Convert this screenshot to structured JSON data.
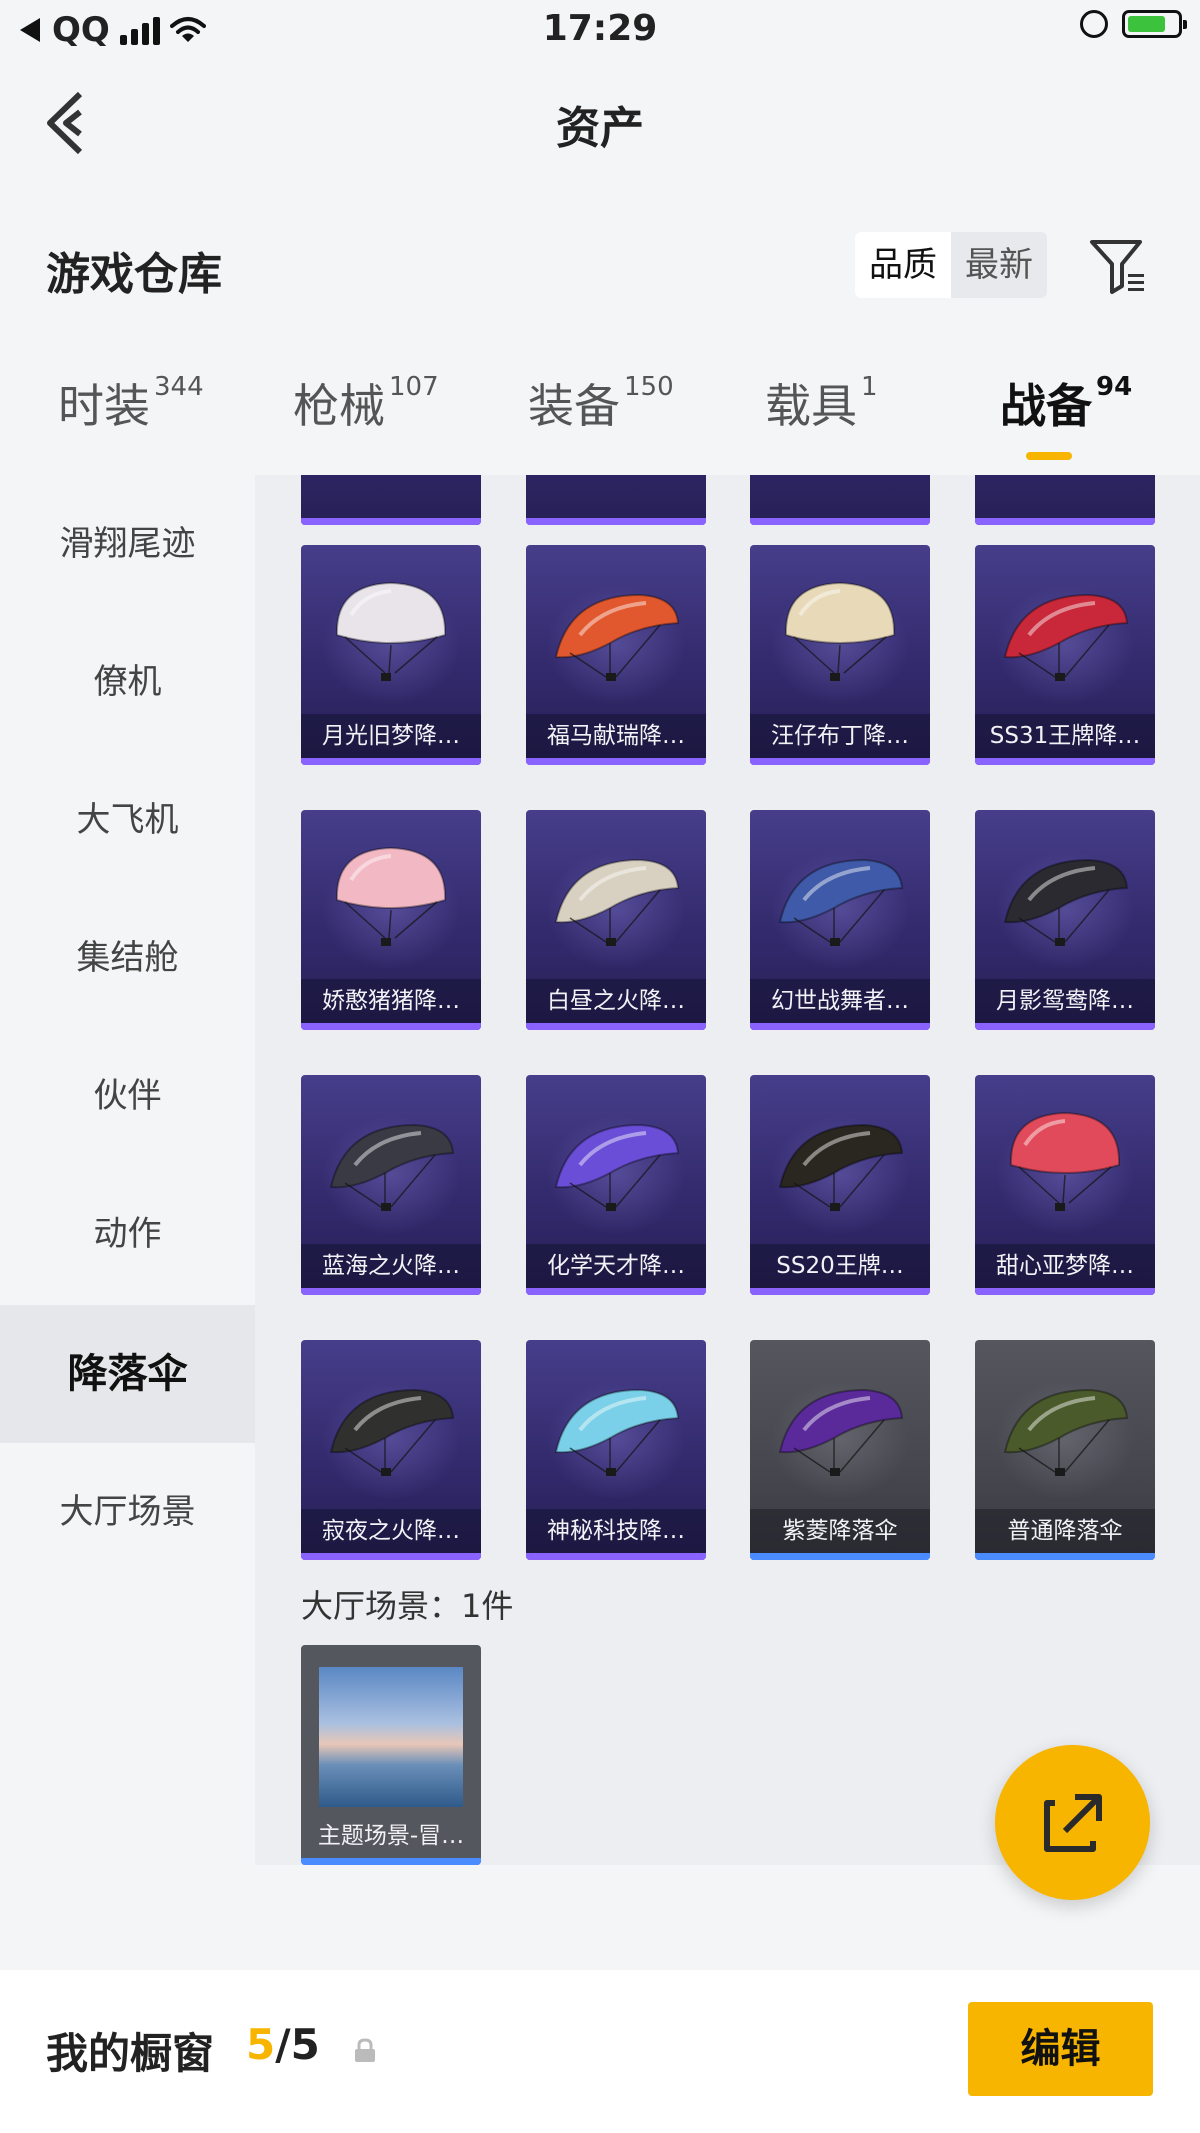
{
  "status_bar": {
    "carrier": "QQ",
    "time": "17:29"
  },
  "header": {
    "title": "资产"
  },
  "section": {
    "title": "游戏仓库",
    "sort_options": [
      "品质",
      "最新"
    ]
  },
  "tabs": [
    {
      "label": "时装",
      "count": "344"
    },
    {
      "label": "枪械",
      "count": "107"
    },
    {
      "label": "装备",
      "count": "150"
    },
    {
      "label": "载具",
      "count": "1"
    },
    {
      "label": "战备",
      "count": "94"
    }
  ],
  "active_tab": "战备",
  "sidebar": [
    {
      "label": "滑翔尾迹"
    },
    {
      "label": "僚机"
    },
    {
      "label": "大飞机"
    },
    {
      "label": "集结舱"
    },
    {
      "label": "伙伴"
    },
    {
      "label": "动作"
    },
    {
      "label": "降落伞"
    },
    {
      "label": "大厅场景"
    }
  ],
  "active_sidebar": "降落伞",
  "items": [
    {
      "name": "月光旧梦降…",
      "color": "#e8e4ea",
      "style": "dome"
    },
    {
      "name": "福马献瑞降…",
      "color": "#e2582e",
      "style": "wing"
    },
    {
      "name": "汪仔布丁降…",
      "color": "#e8d9b8",
      "style": "dome"
    },
    {
      "name": "SS31王牌降…",
      "color": "#c8283a",
      "style": "wing"
    },
    {
      "name": "娇憨猪猪降…",
      "color": "#f2b8c4",
      "style": "dome"
    },
    {
      "name": "白昼之火降…",
      "color": "#d8d0c0",
      "style": "wing"
    },
    {
      "name": "幻世战舞者…",
      "color": "#3e5aa8",
      "style": "wing"
    },
    {
      "name": "月影鸳鸯降…",
      "color": "#2a2a30",
      "style": "wing"
    },
    {
      "name": "蓝海之火降…",
      "color": "#3a3a44",
      "style": "wing"
    },
    {
      "name": "化学天才降…",
      "color": "#6a4ed8",
      "style": "wing"
    },
    {
      "name": "SS20王牌…",
      "color": "#2a2620",
      "style": "wing"
    },
    {
      "name": "甜心亚梦降…",
      "color": "#e04a5a",
      "style": "dome"
    },
    {
      "name": "寂夜之火降…",
      "color": "#30302e",
      "style": "wing"
    },
    {
      "name": "神秘科技降…",
      "color": "#7ad0e8",
      "style": "wing"
    },
    {
      "name": "紫菱降落伞",
      "color": "#5a2a9a",
      "style": "wing",
      "gray": true
    },
    {
      "name": "普通降落伞",
      "color": "#4a5a2a",
      "style": "wing",
      "gray": true
    }
  ],
  "scene_section": {
    "title": "大厅场景：1件",
    "item_name": "主题场景-冒…"
  },
  "bottom_bar": {
    "label": "我的橱窗",
    "current": "5",
    "total": "/5",
    "edit_label": "编辑"
  },
  "colors": {
    "accent": "#f7b500",
    "card_purple": "#3a3178",
    "card_gray": "#4a4b52"
  }
}
